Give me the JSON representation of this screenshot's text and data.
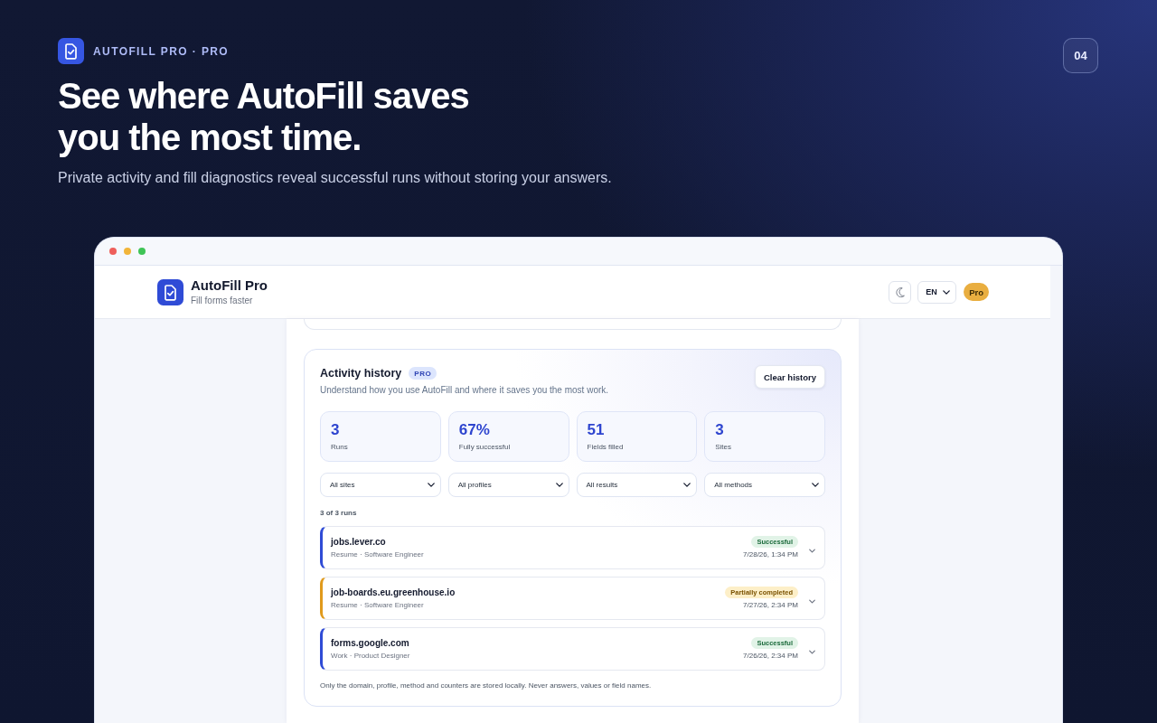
{
  "brand": {
    "label": "AUTOFILL PRO · PRO"
  },
  "slide_number": "04",
  "headline": [
    "See where AutoFill saves",
    "you the most time."
  ],
  "subtitle": "Private activity and fill diagnostics reveal successful runs without storing your answers.",
  "browser": {
    "app_header": {
      "title": "AutoFill Pro",
      "tagline": "Fill forms faster",
      "language": "EN",
      "plan_badge": "Pro"
    },
    "activity": {
      "title": "Activity history",
      "badge": "PRO",
      "description": "Understand how you use AutoFill and where it saves you the most work.",
      "clear_button": "Clear history",
      "stats": [
        {
          "value": "3",
          "label": "Runs"
        },
        {
          "value": "67%",
          "label": "Fully successful"
        },
        {
          "value": "51",
          "label": "Fields filled"
        },
        {
          "value": "3",
          "label": "Sites"
        }
      ],
      "filters": [
        {
          "value": "All sites"
        },
        {
          "value": "All profiles"
        },
        {
          "value": "All results"
        },
        {
          "value": "All methods"
        }
      ],
      "count": "3 of 3 runs",
      "runs": [
        {
          "domain": "jobs.lever.co",
          "meta": "Resume · Software Engineer",
          "status": "Successful",
          "kind": "success",
          "date": "7/28/26, 1:34 PM",
          "expanded": false
        },
        {
          "domain": "job-boards.eu.greenhouse.io",
          "meta": "Resume · Software Engineer",
          "status": "Partially completed",
          "kind": "partial",
          "date": "7/27/26, 2:34 PM",
          "expanded": false
        },
        {
          "domain": "forms.google.com",
          "meta": "Work · Product Designer",
          "status": "Successful",
          "kind": "success",
          "date": "7/26/26, 2:34 PM",
          "expanded": false
        }
      ],
      "note": "Only the domain, profile, method and counters are stored locally. Never answers, values or field names."
    }
  }
}
